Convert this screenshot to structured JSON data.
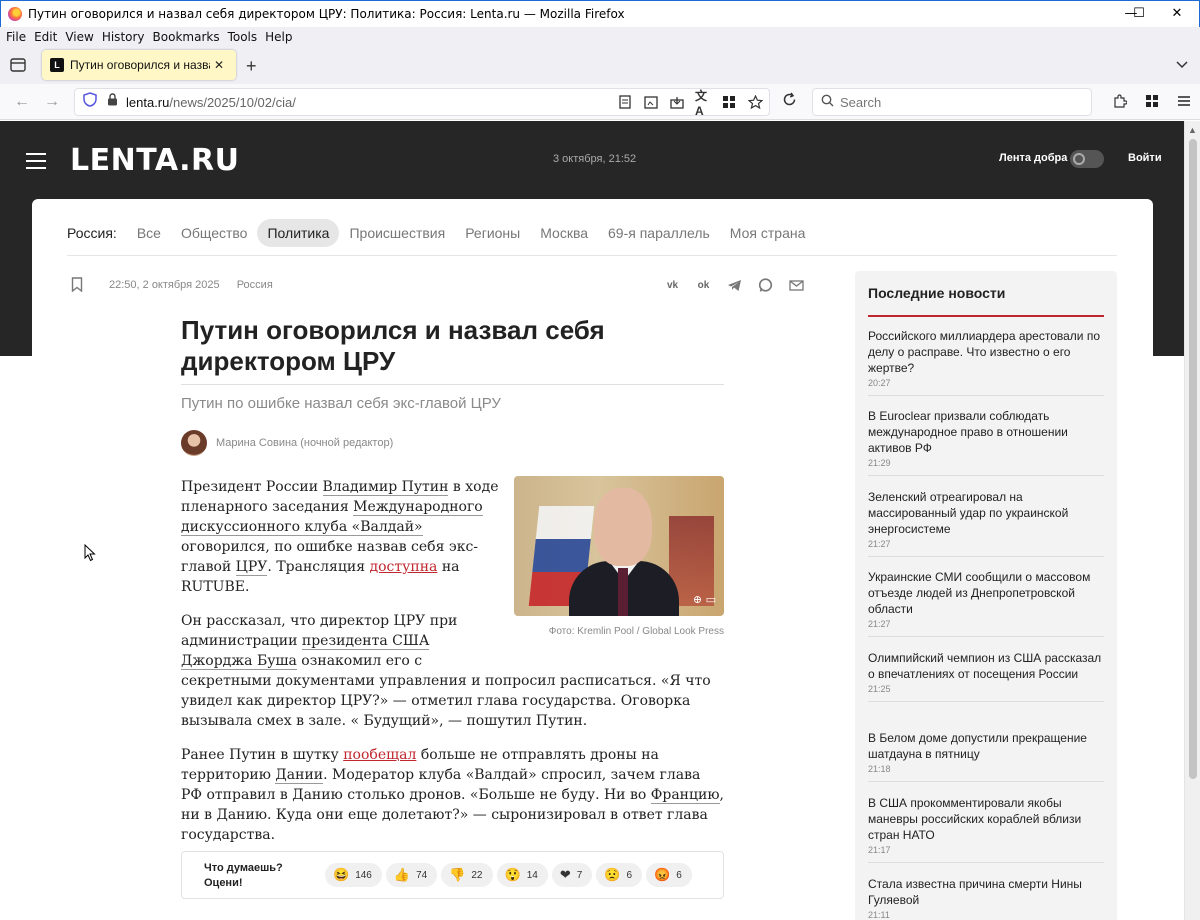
{
  "window": {
    "title": "Путин оговорился и назвал себя директором ЦРУ: Политика: Россия: Lenta.ru — Mozilla Firefox",
    "minimize": "—",
    "maximize": "☐",
    "close": "✕"
  },
  "menu": [
    "File",
    "Edit",
    "View",
    "History",
    "Bookmarks",
    "Tools",
    "Help"
  ],
  "tab": {
    "favicon": "L",
    "label": "Путин оговорился и назвал се",
    "close": "✕"
  },
  "nav": {
    "url_host": "lenta.ru",
    "url_path": "/news/2025/10/02/cia/",
    "search_placeholder": "Search"
  },
  "site": {
    "logo": "LENTA.RU",
    "date": "3 октября, 21:52",
    "kindness": "Лента добра",
    "login": "Войти"
  },
  "rubrics": {
    "label": "Россия:",
    "items": [
      "Все",
      "Общество",
      "Политика",
      "Происшествия",
      "Регионы",
      "Москва",
      "69-я параллель",
      "Моя страна"
    ],
    "active": "Политика"
  },
  "article": {
    "datetime": "22:50, 2 октября 2025",
    "rubric": "Россия",
    "headline": "Путин оговорился и назвал себя директором ЦРУ",
    "subtitle": "Путин по ошибке назвал себя экс-главой ЦРУ",
    "author": "Марина Совина (ночной редактор)",
    "photo_caption": "Фото: Kremlin Pool / Global Look Press",
    "p1": {
      "a": "Президент России ",
      "link1": "Владимир Путин",
      "b": " в ходе пленарного заседания ",
      "link2": "Международного дискуссионного клуба «Валдай»",
      "c": " оговорился, по ошибке назвав себя экс-главой ",
      "link3": "ЦРУ",
      "d": ". Трансляция ",
      "link4": "доступна",
      "e": " на RUTUBE."
    },
    "p2": {
      "a": "Он рассказал, что директор ЦРУ при администрации ",
      "link1": "президента США Джорджа Буша",
      "b": " ознакомил его с секретными документами управления и попросил расписаться. «Я что увидел как директор ЦРУ?» — отметил глава государства. Оговорка вызывала смех в зале. « Будущий», — пошутил Путин."
    },
    "p3": {
      "a": "Ранее Путин в шутку ",
      "link1": "пообещал",
      "b": " больше не отправлять дроны на территорию ",
      "link2": "Дании",
      "c": ". Модератор клуба «Валдай» спросил, зачем глава РФ отправил в Данию столько дронов. «Больше не буду. Ни во ",
      "link3": "Францию",
      "d": ", ни в Данию. Куда они еще долетают?» — сыронизировал в ответ глава государства."
    }
  },
  "reactions": {
    "question_line1": "Что думаешь?",
    "question_line2": "Оцени!",
    "items": [
      {
        "emoji": "😆",
        "icon": "laughing-icon",
        "count": "146"
      },
      {
        "emoji": "👍",
        "icon": "thumbs-up-icon",
        "count": "74"
      },
      {
        "emoji": "👎",
        "icon": "thumbs-down-icon",
        "count": "22"
      },
      {
        "emoji": "😲",
        "icon": "shocked-icon",
        "count": "14"
      },
      {
        "emoji": "❤",
        "icon": "heart-icon",
        "count": "7"
      },
      {
        "emoji": "😟",
        "icon": "sad-icon",
        "count": "6"
      },
      {
        "emoji": "😡",
        "icon": "angry-icon",
        "count": "6"
      }
    ]
  },
  "sidebar": {
    "title": "Последние новости",
    "news": [
      {
        "title": "Российского миллиардера арестовали по делу о расправе. Что известно о его жертве?",
        "time": "20:27"
      },
      {
        "title": "В Euroclear призвали соблюдать международное право в отношении активов РФ",
        "time": "21:29"
      },
      {
        "title": "Зеленский отреагировал на массированный удар по украинской энергосистеме",
        "time": "21:27"
      },
      {
        "title": "Украинские СМИ сообщили о массовом отъезде людей из Днепропетровской области",
        "time": "21:27"
      },
      {
        "title": "Олимпийский чемпион из США рассказал о впечатлениях от посещения России",
        "time": "21:25"
      },
      {
        "title": "В Белом доме допустили прекращение шатдауна в пятницу",
        "time": "21:18"
      },
      {
        "title": "В США прокомментировали якобы маневры российских кораблей вблизи стран НАТО",
        "time": "21:17"
      },
      {
        "title": "Стала известна причина смерти Нины Гуляевой",
        "time": "21:11"
      }
    ]
  },
  "colors": {
    "header_bg": "#262626",
    "accent_red": "#c0262d",
    "tab_bg": "#fff8c6"
  }
}
